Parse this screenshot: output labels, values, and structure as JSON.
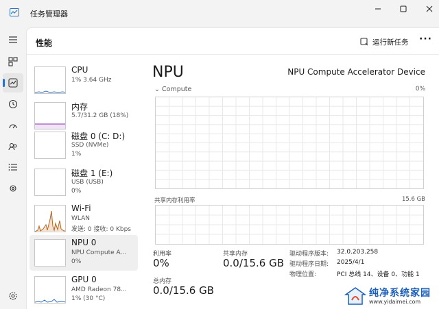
{
  "window": {
    "title": "任务管理器"
  },
  "header": {
    "page_title": "性能",
    "run_task_label": "运行新任务",
    "more_label": "···"
  },
  "devices": [
    {
      "name": "CPU",
      "sub": "1% 3.64 GHz",
      "sub2": "",
      "color": "#2f6fbf"
    },
    {
      "name": "内存",
      "sub": "5.7/31.2 GB (18%)",
      "sub2": "",
      "color": "#8b2fb0"
    },
    {
      "name": "磁盘 0 (C: D:)",
      "sub": "SSD (NVMe)",
      "sub2": "1%",
      "color": "#3a9a3a"
    },
    {
      "name": "磁盘 1 (E:)",
      "sub": "USB (USB)",
      "sub2": "0%",
      "color": "#3a9a3a"
    },
    {
      "name": "Wi-Fi",
      "sub": "WLAN",
      "sub2": "发送: 0 接收: 0 Kbps",
      "color": "#b5641f"
    },
    {
      "name": "NPU 0",
      "sub": "NPU Compute A...",
      "sub2": "0%",
      "color": "#2f6fbf"
    },
    {
      "name": "GPU 0",
      "sub": "AMD Radeon 78...",
      "sub2": "1% (30 °C)",
      "color": "#2f6fbf"
    }
  ],
  "detail": {
    "title": "NPU",
    "device_name": "NPU Compute Accelerator Device",
    "compute_label": "Compute",
    "compute_pct": "0%",
    "shared_mem_label": "共享内存利用率",
    "shared_mem_max": "15.6 GB",
    "stats": {
      "utilization_label": "利用率",
      "utilization_value": "0%",
      "shared_mem_label": "共享内存",
      "shared_mem_value": "0.0/15.6 GB",
      "total_mem_label": "总内存",
      "total_mem_value": "0.0/15.6 GB"
    },
    "info": [
      {
        "key": "驱动程序版本:",
        "value": "32.0.203.258"
      },
      {
        "key": "驱动程序日期:",
        "value": "2025/4/1"
      },
      {
        "key": "物理位置:",
        "value": "PCI 总线 14、设备 0、功能 1"
      }
    ]
  },
  "watermark": {
    "name": "纯净系统家园",
    "url": "www.yidaimei.com"
  },
  "colors": {
    "accent": "#2f6fbf",
    "graph_border": "#d0d0d0",
    "grid": "#e8e8e8"
  }
}
